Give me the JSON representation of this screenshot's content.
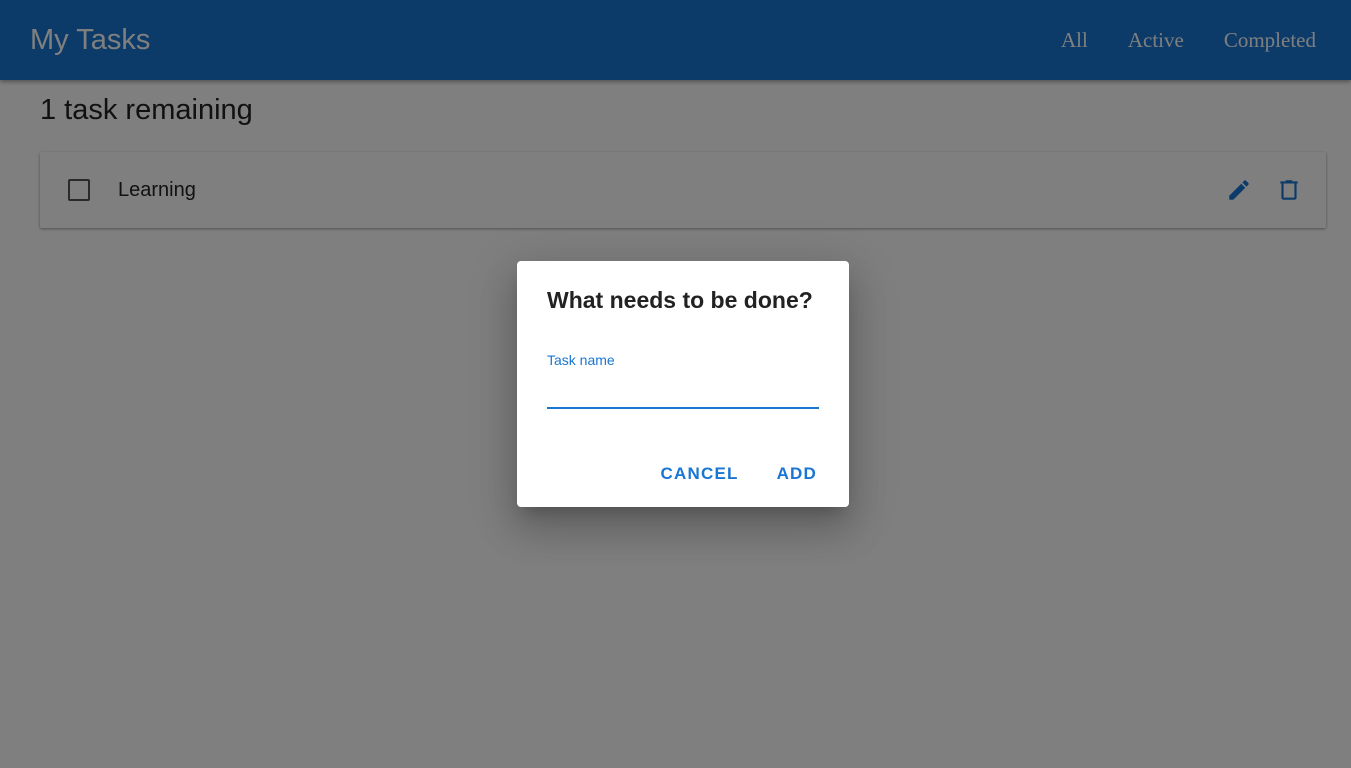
{
  "app": {
    "title": "My Tasks",
    "nav": [
      "All",
      "Active",
      "Completed"
    ]
  },
  "summary": {
    "remaining": "1 task remaining"
  },
  "tasks": [
    {
      "label": "Learning",
      "completed": false
    }
  ],
  "icons": {
    "edit": "pencil-icon",
    "delete": "trash-icon"
  },
  "dialog": {
    "title": "What needs to be done?",
    "field_label": "Task name",
    "field_value": "",
    "cancel_label": "CANCEL",
    "add_label": "ADD"
  },
  "colors": {
    "primary": "#1976d2",
    "overlay": "rgba(0,0,0,0.5)"
  }
}
